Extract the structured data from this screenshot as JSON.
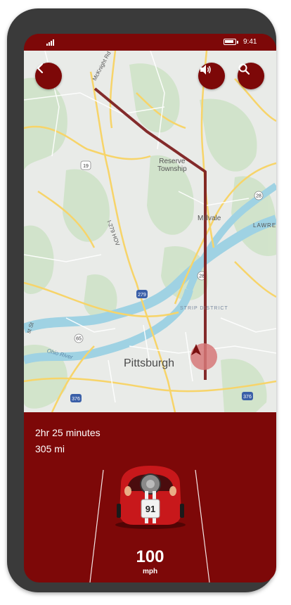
{
  "status_bar": {
    "time": "9:41",
    "icons": [
      "signal-icon",
      "battery-icon"
    ]
  },
  "map": {
    "labels": {
      "city": "Pittsburgh",
      "reserve": "Reserve\nTownship",
      "millvale": "Millvale",
      "strip_district": "STRIP DISTRICT",
      "ohio_river": "Ohio River",
      "mcknight": "McKnight Rd",
      "i279": "I-279 HOV",
      "lawrence": "LAWREN",
      "st": "st St"
    },
    "shields": [
      "19",
      "279",
      "28",
      "28",
      "65",
      "376",
      "376"
    ]
  },
  "buttons": {
    "back": "chevron-left-icon",
    "sound": "speaker-icon",
    "search": "search-icon"
  },
  "trip": {
    "duration": "2hr 25 minutes",
    "distance": "305 mi"
  },
  "car": {
    "number": "91"
  },
  "speed": {
    "value": "100",
    "unit": "mph"
  },
  "colors": {
    "brand": "#7d0808",
    "route": "#7a1a1a"
  }
}
